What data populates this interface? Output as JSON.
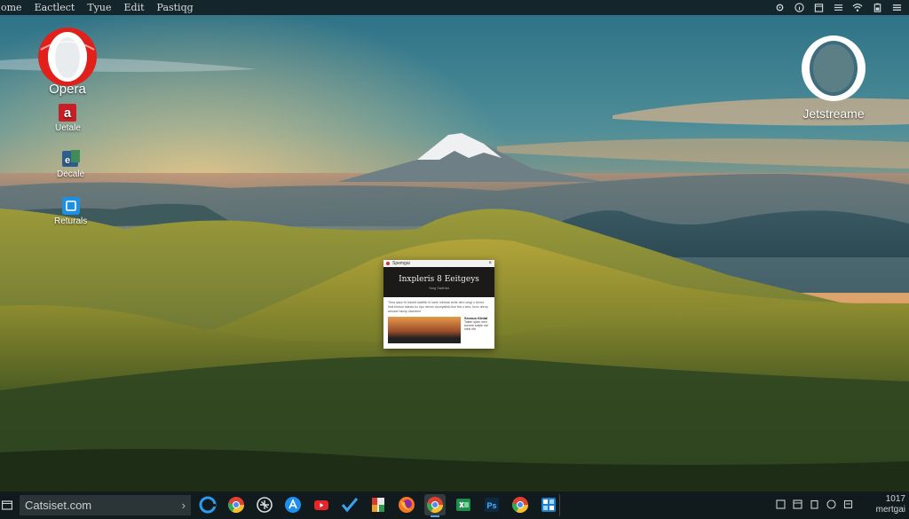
{
  "menubar": {
    "items": [
      "ome",
      "Eactlect",
      "Tyue",
      "Edit",
      "Pastiqg"
    ]
  },
  "desktop_icons": {
    "opera": "Opera",
    "jetstream": "Jetstreame",
    "update": "Uetale",
    "decale": "Decale",
    "returals": "Returals"
  },
  "window": {
    "tab_title": "Spemgai",
    "hero_title": "Inxpleris 8 Eeitgeys",
    "hero_sub": "Yarg Sadhlar",
    "body_text": "Thea ipsun fe traokti haefbtir fo tsere intrreae tmhe dem ontgi o bemrt. Nutl brstum tatecio bo ripo drenrn duonyalisio tlue fea o seto, tnoiv drenp amuloe hacnp niwmtere",
    "side_title": "Sronuo Kintal",
    "side_text": "Tatlen sjicm wen toomre sufyle rde nlirsl nfe"
  },
  "taskbar": {
    "search_text": "Catsiset.com",
    "clock_time": "1017",
    "clock_date": "mertgai"
  },
  "colors": {
    "opera_red": "#e0201b",
    "menubar_bg": "#121e24",
    "taskbar_bg": "#101a1e"
  }
}
